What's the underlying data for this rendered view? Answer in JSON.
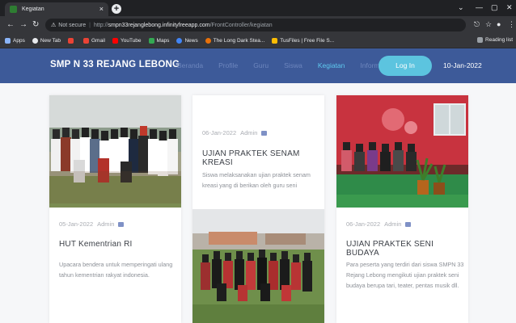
{
  "browser": {
    "tab_title": "Kegiatan",
    "tab_close": "×",
    "new_tab": "+",
    "url_warning": "⚠",
    "url_not_secure": "Not secure",
    "url_sep": "|",
    "url_scheme": "http://",
    "url_host": "smpn33rejanglebong.infinityfreeapp.com",
    "url_path": "/FrontController/kegiatan",
    "bookmarks": [
      {
        "label": "Apps",
        "color": "#8ab4f8"
      },
      {
        "label": "New Tab",
        "color": "#e8eaed"
      },
      {
        "label": "",
        "color": "#ea4335"
      },
      {
        "label": "Gmail",
        "color": "#ea4335"
      },
      {
        "label": "YouTube",
        "color": "#ff0000"
      },
      {
        "label": "Maps",
        "color": "#34a853"
      },
      {
        "label": "News",
        "color": "#4285f4"
      },
      {
        "label": "The Long Dark Stea...",
        "color": "#e8710a"
      },
      {
        "label": "TusFiles | Free File S...",
        "color": "#fbbc04"
      }
    ],
    "reading_list": "Reading list"
  },
  "site": {
    "brand": "SMP N 33 REJANG LEBONG",
    "menu": [
      {
        "label": "Beranda",
        "active": false
      },
      {
        "label": "Profile",
        "active": false
      },
      {
        "label": "Guru",
        "active": false
      },
      {
        "label": "Siswa",
        "active": false
      },
      {
        "label": "Kegiatan",
        "active": true
      },
      {
        "label": "Informasi",
        "active": false
      }
    ],
    "login_label": "Log In",
    "date": "10-Jan-2022",
    "accent_color": "#3d5a99",
    "login_color": "#5cc4df"
  },
  "cards": [
    {
      "date": "05-Jan-2022",
      "author": "Admin",
      "title": "HUT Kementrian RI",
      "desc": "Upacara bendera untuk memperingati ulang tahun kementrian rakyat indonesia."
    },
    {
      "date": "06-Jan-2022",
      "author": "Admin",
      "title": "UJIAN PRAKTEK SENAM KREASI",
      "desc": "Siswa melaksanakan ujian praktek senam kreasi yang di berikan oleh guru seni"
    },
    {
      "date": "06-Jan-2022",
      "author": "Admin",
      "title": "UJIAN PRAKTEK SENI BUDAYA",
      "desc": "Para peserta yang terdiri dari siswa SMPN 33 Rejang Lebong mengikuti ujian praktek seni budaya berupa tari, teater, pentas musik dll."
    }
  ]
}
